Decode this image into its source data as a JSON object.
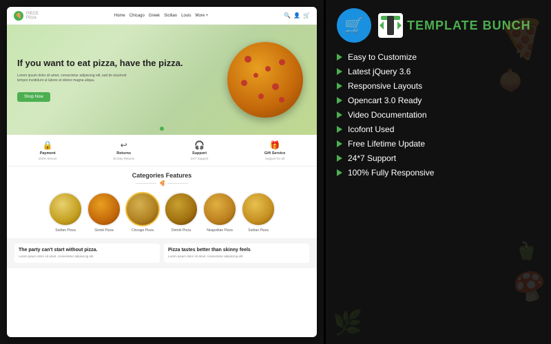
{
  "left": {
    "site": {
      "logo_name": "PIECE",
      "logo_sub": "Pizza",
      "nav_items": [
        "Home",
        "Chicago",
        "Greek",
        "Sicilian",
        "Louis",
        "More +"
      ],
      "hero": {
        "title": "If you want to eat pizza, have the pizza.",
        "description": "Lorem ipsum dolor sit amet, consectetur adipiscing elit, sed do eiusmod tempor incididunt ut labore et dolore magna aliqua.",
        "button": "Shop Now"
      },
      "features": [
        {
          "icon": "🔒",
          "title": "Payment",
          "sub": "100% Secure"
        },
        {
          "icon": "↩",
          "title": "Returns",
          "sub": "30 Day Returns"
        },
        {
          "icon": "🎧",
          "title": "Support",
          "sub": "24/7 Support"
        },
        {
          "icon": "🎁",
          "title": "Gift Service",
          "sub": "Support for all"
        }
      ],
      "categories_title": "Categories Features",
      "pizzas": [
        {
          "name": "Sicilian Pizza"
        },
        {
          "name": "Greek Pizza"
        },
        {
          "name": "Chicago Pizza"
        },
        {
          "name": "Detroit Pizza"
        },
        {
          "name": "Neapolitan Pizza"
        },
        {
          "name": "Sicilian Pizza"
        }
      ],
      "bottom_cards": [
        {
          "title": "The party can't start without pizza.",
          "text": "Lorem ipsum dolor sit amet, consectetur adipiscing elit."
        },
        {
          "title": "Pizza tastes better than skinny feels",
          "text": "Lorem ipsum dolor sit amet, consectetur adipiscing elit."
        }
      ]
    }
  },
  "right": {
    "brand_name": "teMplATe BUnCh",
    "brand_display": "TEMPLATE BUNCH",
    "features": [
      {
        "label": "Easy to Customize"
      },
      {
        "label": "Latest jQuery 3.6"
      },
      {
        "label": "Responsive Layouts"
      },
      {
        "label": "Opencart 3.0 Ready"
      },
      {
        "label": "Video Documentation"
      },
      {
        "label": "Icofont Used"
      },
      {
        "label": "Free Lifetime Update"
      },
      {
        "label": "24*7 Support"
      },
      {
        "label": "100% Fully Responsive"
      }
    ]
  }
}
